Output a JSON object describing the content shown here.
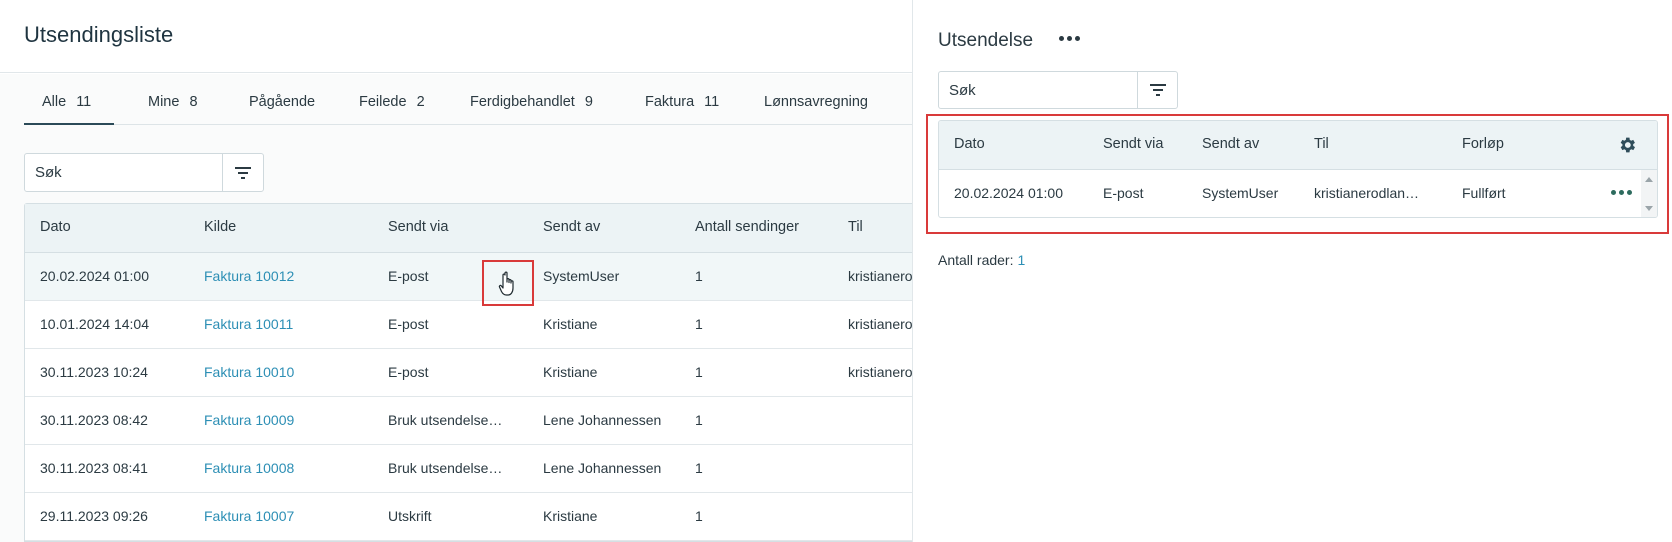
{
  "page": {
    "title": "Utsendingsliste"
  },
  "tabs": [
    {
      "label": "Alle",
      "count": "11"
    },
    {
      "label": "Mine",
      "count": "8"
    },
    {
      "label": "Pågående",
      "count": ""
    },
    {
      "label": "Feilede",
      "count": "2"
    },
    {
      "label": "Ferdigbehandlet",
      "count": "9"
    },
    {
      "label": "Faktura",
      "count": "11"
    },
    {
      "label": "Lønnsavregning",
      "count": ""
    }
  ],
  "search": {
    "placeholder": "Søk"
  },
  "table": {
    "columns": [
      "Dato",
      "Kilde",
      "Sendt via",
      "Sendt av",
      "Antall sendinger",
      "Til"
    ],
    "rows": [
      {
        "dato": "20.02.2024 01:00",
        "kilde": "Faktura 10012",
        "sendt_via": "E-post",
        "sendt_av": "SystemUser",
        "antall": "1",
        "til": "kristianerodlandfjellheim@example.no"
      },
      {
        "dato": "10.01.2024 14:04",
        "kilde": "Faktura 10011",
        "sendt_via": "E-post",
        "sendt_av": "Kristiane",
        "antall": "1",
        "til": "kristianerodlandfjellheim@example.no"
      },
      {
        "dato": "30.11.2023 10:24",
        "kilde": "Faktura 10010",
        "sendt_via": "E-post",
        "sendt_av": "Kristiane",
        "antall": "1",
        "til": "kristianerodlandfjellheim@example.no"
      },
      {
        "dato": "30.11.2023 08:42",
        "kilde": "Faktura 10009",
        "sendt_via": "Bruk utsendelse…",
        "sendt_av": "Lene Johannessen",
        "antall": "1",
        "til": ""
      },
      {
        "dato": "30.11.2023 08:41",
        "kilde": "Faktura 10008",
        "sendt_via": "Bruk utsendelse…",
        "sendt_av": "Lene Johannessen",
        "antall": "1",
        "til": ""
      },
      {
        "dato": "29.11.2023 09:26",
        "kilde": "Faktura 10007",
        "sendt_via": "Utskrift",
        "sendt_av": "Kristiane",
        "antall": "1",
        "til": ""
      }
    ]
  },
  "panel": {
    "title": "Utsendelse",
    "search": {
      "placeholder": "Søk"
    },
    "columns": [
      "Dato",
      "Sendt via",
      "Sendt av",
      "Til",
      "Forløp"
    ],
    "rows": [
      {
        "dato": "20.02.2024 01:00",
        "sendt_via": "E-post",
        "sendt_av": "SystemUser",
        "til": "kristianerodlan…",
        "forlop": "Fullført"
      }
    ],
    "row_count_label": "Antall rader:",
    "row_count": "1"
  },
  "icons": {
    "filter": "filter-icon",
    "more": "more-horizontal-icon",
    "settings": "gear-icon",
    "cursor": "hand-pointer-icon"
  },
  "colors": {
    "link": "#2d8fb5",
    "header_bg": "#ecf3f5",
    "highlight": "#d93a3a",
    "accent_dark": "#2b4a58"
  }
}
